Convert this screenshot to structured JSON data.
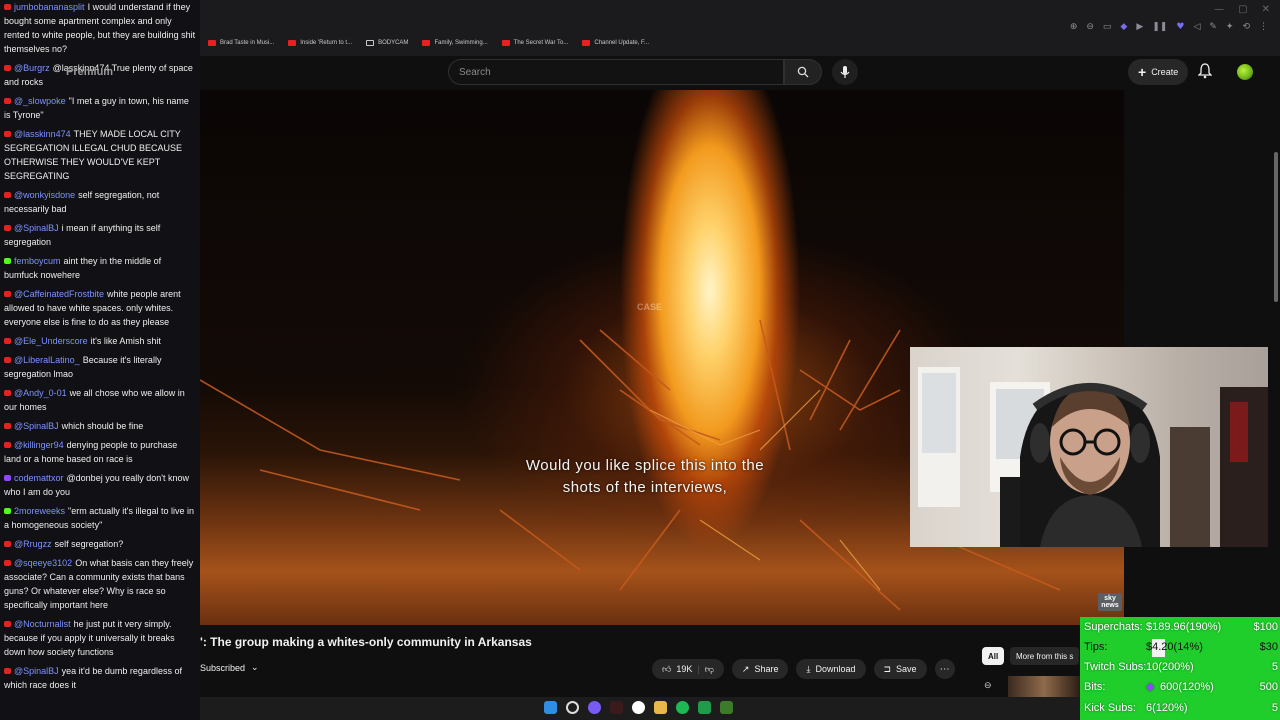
{
  "browser": {
    "bookmarks": [
      {
        "label": "Brad Taste in Musi...",
        "icon": "youtube"
      },
      {
        "label": "Inside 'Return to t...",
        "icon": "youtube"
      },
      {
        "label": "BODYCAM",
        "icon": "folder"
      },
      {
        "label": "Family, Swimming...",
        "icon": "youtube"
      },
      {
        "label": "The Secret War To...",
        "icon": "youtube"
      },
      {
        "label": "Channel Update, F...",
        "icon": "youtube"
      }
    ]
  },
  "youtube": {
    "search_placeholder": "Search",
    "create_label": "Create",
    "premium_label": "Premium"
  },
  "video": {
    "caption_line1": "Would you like splice this into the",
    "caption_line2": "shots of the interviews,",
    "watermark": "CASE",
    "logo_text": "sky news",
    "title": "': The group making a whites-only community in Arkansas",
    "subscribed_label": "Subscribed",
    "likes": "19K",
    "share_label": "Share",
    "download_label": "Download",
    "save_label": "Save",
    "chip_all": "All",
    "chip_more": "More from this s"
  },
  "chat": [
    {
      "platform": "yt",
      "user": "jumbobananasplit",
      "text": "I would understand if they bought some apartment complex and only rented to white people, but they are building shit themselves no?"
    },
    {
      "platform": "yt",
      "user": "@Burgrz",
      "text": "@lasskinn474 True plenty of space and rocks"
    },
    {
      "platform": "yt",
      "user": "@_slowpoke",
      "text": "\"I met a guy in town, his name is Tyrone\""
    },
    {
      "platform": "yt",
      "user": "@lasskinn474",
      "text": "THEY MADE LOCAL CITY SEGREGATION ILLEGAL CHUD BECAUSE OTHERWISE THEY WOULD'VE KEPT SEGREGATING"
    },
    {
      "platform": "yt",
      "user": "@wonkyisdone",
      "text": "self segregation, not necessarily bad"
    },
    {
      "platform": "yt",
      "user": "@SpinalBJ",
      "text": "i mean if anything its self segregation"
    },
    {
      "platform": "kick",
      "user": "femboycum",
      "text": "aint they in the middle of bumfuck nowehere"
    },
    {
      "platform": "yt",
      "user": "@CaffeinatedFrostbite",
      "text": "white people arent allowed to have white spaces. only whites. everyone else is fine to do as they please"
    },
    {
      "platform": "yt",
      "user": "@Ele_Underscore",
      "text": "it's like Amish shit"
    },
    {
      "platform": "yt",
      "user": "@LiberalLatino_",
      "text": "Because it's literally segregation lmao"
    },
    {
      "platform": "yt",
      "user": "@Andy_0-01",
      "text": "we all chose who we allow in our homes"
    },
    {
      "platform": "yt",
      "user": "@SpinalBJ",
      "text": "which should be fine"
    },
    {
      "platform": "yt",
      "user": "@killinger94",
      "text": "denying people to purchase land or a home based on race is"
    },
    {
      "platform": "twitch",
      "user": "codemattxor",
      "text": "@donbej you really don't know who I am do you"
    },
    {
      "platform": "kick",
      "user": "2moreweeks",
      "text": "\"erm actually it's illegal to live in a homogeneous society\""
    },
    {
      "platform": "yt",
      "user": "@Rrugzz",
      "text": "self segregation?"
    },
    {
      "platform": "yt",
      "user": "@sqeeye3102",
      "text": "On what basis can they freely associate? Can a community exists that bans guns? Or whatever else? Why is race so specifically important here"
    },
    {
      "platform": "yt",
      "user": "@Nocturnalist",
      "text": "he just put it very simply. because if you apply it universally it breaks down how society functions"
    },
    {
      "platform": "yt",
      "user": "@SpinalBJ",
      "text": "yea it'd be dumb regardless of which race does it"
    }
  ],
  "stats": [
    {
      "label": "Superchats:",
      "value": "$189.96(190%)",
      "goal": "$100",
      "fill_fraction": 1.0
    },
    {
      "label": "Tips:",
      "value": "$4.20(14%)",
      "goal": "$30",
      "fill_fraction": 0.14
    },
    {
      "label": "Twitch Subs:",
      "value": "10(200%)",
      "goal": "5",
      "fill_fraction": 1.0
    },
    {
      "label": "Bits:",
      "value": "600(120%)",
      "goal": "500",
      "fill_fraction": 1.0
    },
    {
      "label": "Kick Subs:",
      "value": "6(120%)",
      "goal": "5",
      "fill_fraction": 1.0
    }
  ],
  "colors": {
    "youtube_red": "#e52222",
    "kick_green": "#53fc18",
    "twitch_purple": "#9146ff",
    "stats_bg": "#1fce2a",
    "username": "#7d93ff"
  }
}
